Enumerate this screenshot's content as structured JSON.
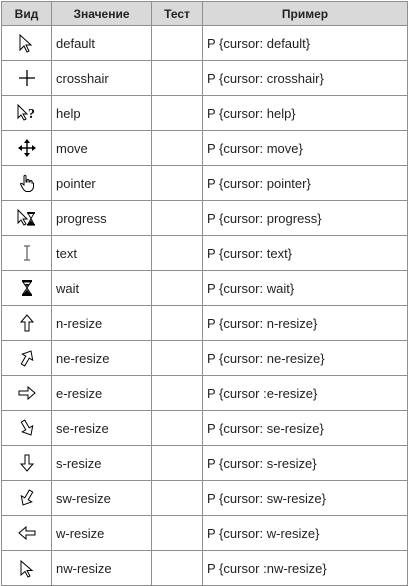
{
  "headers": {
    "icon": "Вид",
    "name": "Значение",
    "test": "Тест",
    "example": "Пример"
  },
  "rows": [
    {
      "icon": "default-arrow-icon",
      "name": "default",
      "test": "",
      "example": "P {cursor: default}"
    },
    {
      "icon": "crosshair-icon",
      "name": "crosshair",
      "test": "",
      "example": "P {cursor: crosshair}"
    },
    {
      "icon": "help-arrow-question-icon",
      "name": "help",
      "test": "",
      "example": "P {cursor: help}"
    },
    {
      "icon": "move-arrows-icon",
      "name": "move",
      "test": "",
      "example": "P {cursor: move}"
    },
    {
      "icon": "pointer-hand-icon",
      "name": "pointer",
      "test": "",
      "example": "P {cursor: pointer}"
    },
    {
      "icon": "progress-arrow-hourglass-icon",
      "name": "progress",
      "test": "",
      "example": "P {cursor: progress}"
    },
    {
      "icon": "text-ibeam-icon",
      "name": "text",
      "test": "",
      "example": "P {cursor: text}"
    },
    {
      "icon": "wait-hourglass-icon",
      "name": "wait",
      "test": "",
      "example": "P {cursor: wait}"
    },
    {
      "icon": "n-resize-arrow-icon",
      "name": "n-resize",
      "test": "",
      "example": "P {cursor: n-resize}"
    },
    {
      "icon": "ne-resize-arrow-icon",
      "name": "ne-resize",
      "test": "",
      "example": "P {cursor: ne-resize}"
    },
    {
      "icon": "e-resize-arrow-icon",
      "name": "e-resize",
      "test": "",
      "example": "P {cursor :e-resize}"
    },
    {
      "icon": "se-resize-arrow-icon",
      "name": "se-resize",
      "test": "",
      "example": "P {cursor: se-resize}"
    },
    {
      "icon": "s-resize-arrow-icon",
      "name": "s-resize",
      "test": "",
      "example": "P {cursor: s-resize}"
    },
    {
      "icon": "sw-resize-arrow-icon",
      "name": "sw-resize",
      "test": "",
      "example": "P {cursor: sw-resize}"
    },
    {
      "icon": "w-resize-arrow-icon",
      "name": "w-resize",
      "test": "",
      "example": "P {cursor: w-resize}"
    },
    {
      "icon": "nw-resize-arrow-icon",
      "name": "nw-resize",
      "test": "",
      "example": "P {cursor :nw-resize}"
    }
  ]
}
